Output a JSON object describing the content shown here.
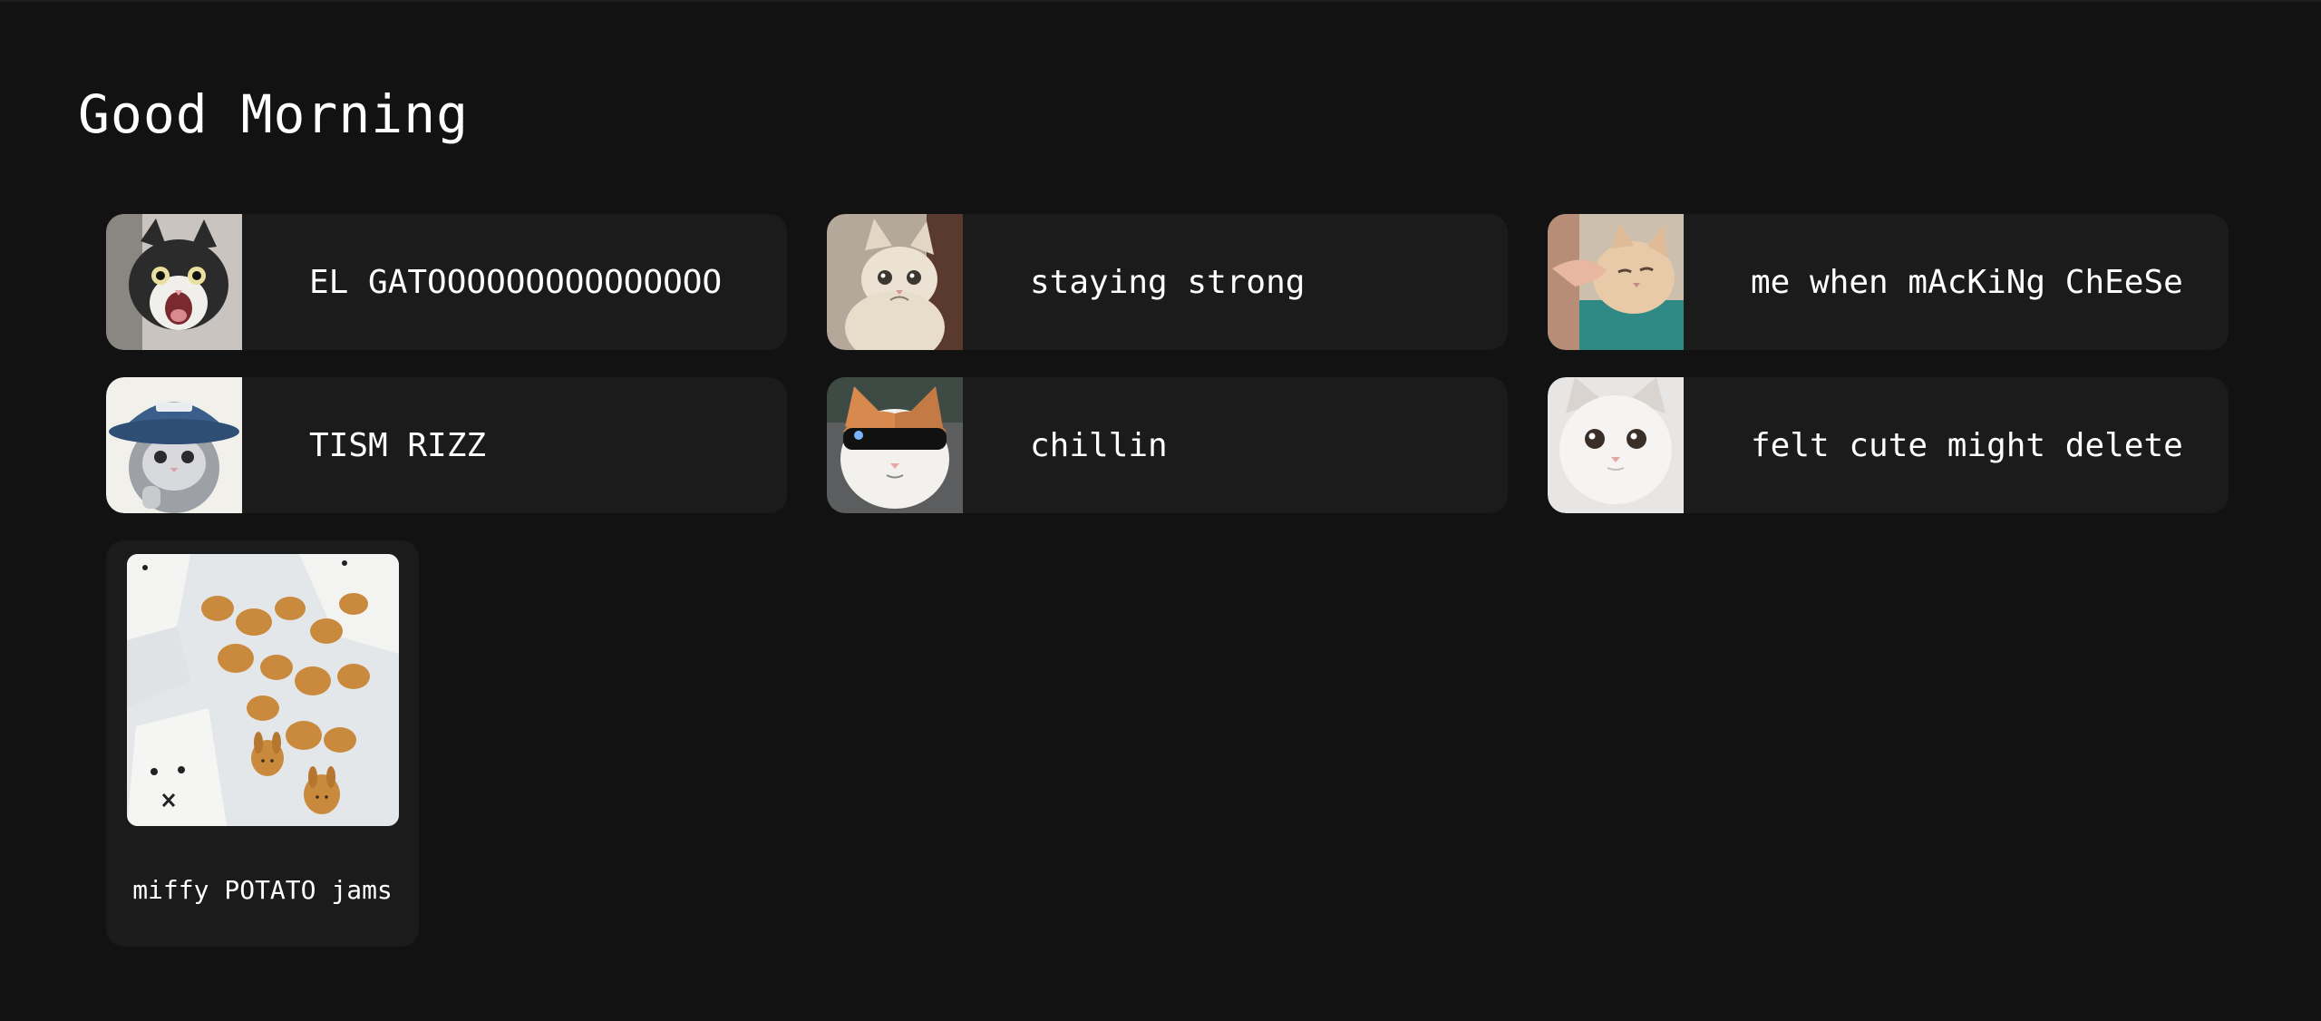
{
  "header": {
    "greeting": "Good Morning"
  },
  "playlists": [
    {
      "label": "EL GATOOOOOOOOOOOOOOO",
      "image": "screaming-cat-image"
    },
    {
      "label": "staying strong",
      "image": "crying-cat-image"
    },
    {
      "label": "me when mAcKiNg ChEeSe",
      "image": "cheek-squish-cat-image"
    },
    {
      "label": "TISM RIZZ",
      "image": "cap-wearing-cat-image"
    },
    {
      "label": "chillin",
      "image": "sunglasses-cat-image"
    },
    {
      "label": "felt cute might delete",
      "image": "white-kitten-image"
    }
  ],
  "featured": {
    "label": "miffy POTATO jams",
    "image": "miffy-potato-snacks-image"
  },
  "colors": {
    "background": "#121212",
    "card": "#1b1b1b",
    "text": "#ffffff"
  }
}
